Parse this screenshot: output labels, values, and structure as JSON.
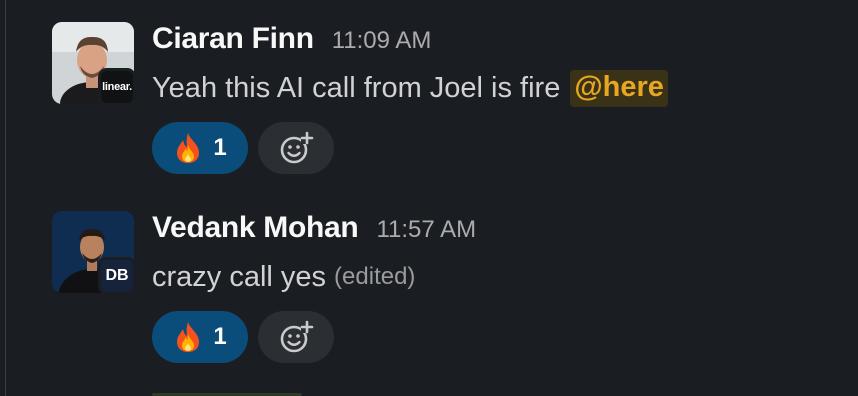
{
  "messages": [
    {
      "sender": "Ciaran Finn",
      "time": "11:09 AM",
      "text": "Yeah this AI call from Joel is fire",
      "mention": "@here",
      "org_badge": "linear.",
      "reaction": {
        "emoji": "🔥",
        "count": "1"
      }
    },
    {
      "sender": "Vedank Mohan",
      "time": "11:57 AM",
      "text": "crazy call yes",
      "edited_label": "(edited)",
      "org_badge": "DB",
      "reaction": {
        "emoji": "🔥",
        "count": "1"
      }
    }
  ],
  "colors": {
    "background": "#1a1d21",
    "mention_text": "#e8a723",
    "mention_bg": "#3a3216",
    "reaction_active_bg": "#0b4d7a",
    "add_reaction_bg": "#2b2e33"
  },
  "icons": {
    "reaction_emoji": "fire-emoji-icon",
    "add_reaction": "add-reaction-smiley-icon"
  }
}
